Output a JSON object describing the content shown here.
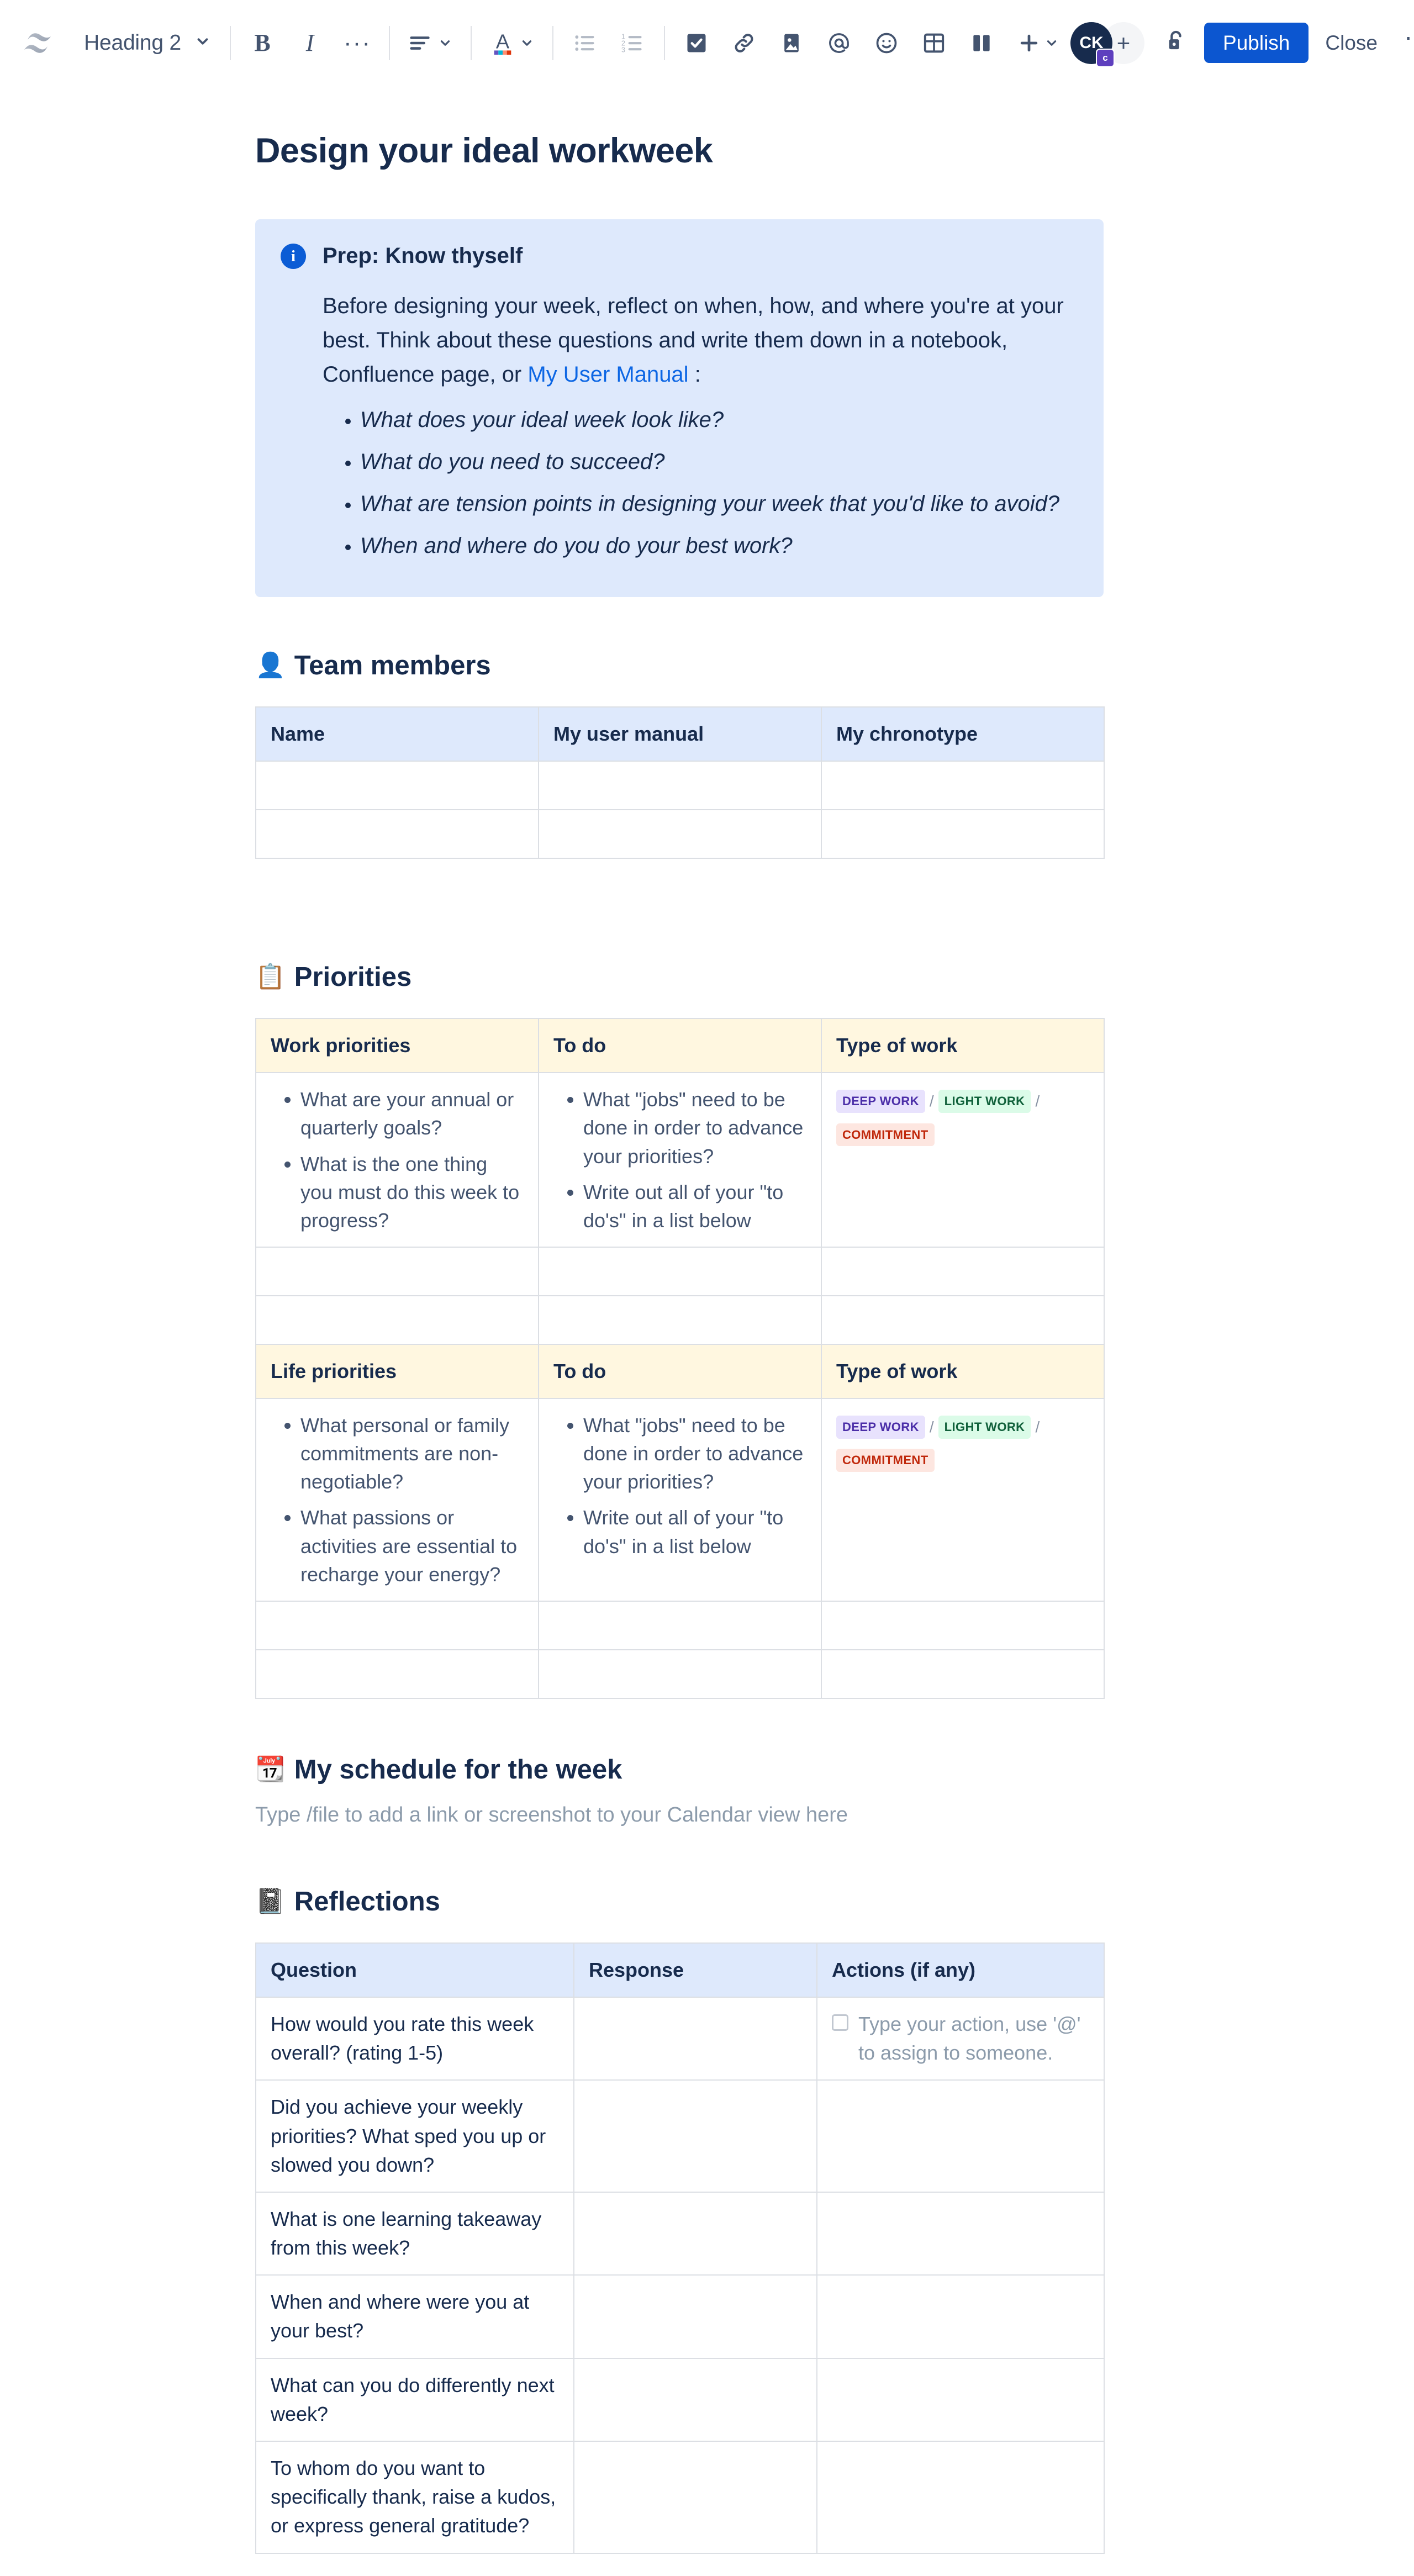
{
  "toolbar": {
    "logo_icon": "confluence-logo-icon",
    "block_type": "Heading 2",
    "bold_label": "B",
    "italic_label": "I",
    "more_formatting_label": "···",
    "icons": [
      "text-align-icon",
      "text-color-icon",
      "bullet-list-icon",
      "numbered-list-icon",
      "action-item-icon",
      "link-icon",
      "image-icon",
      "mention-icon",
      "emoji-icon",
      "table-icon",
      "layout-icon",
      "insert-more-icon"
    ],
    "avatar_initials": "CK",
    "avatar_badge": "c",
    "add_person_label": "+",
    "lock_icon": "unlocked-padlock-icon",
    "publish_label": "Publish",
    "close_label": "Close",
    "overflow_label": "···",
    "accent_color": "#0C56D0"
  },
  "document": {
    "title": "Design your ideal workweek"
  },
  "info_panel": {
    "icon": "info-icon",
    "title": "Prep: Know thyself",
    "body_before_link": "Before designing your week, reflect on when, how, and where you're at your best. Think about these questions and write them down in a notebook, Confluence page, or ",
    "link_text": "My User Manual",
    "body_after_link": " :",
    "questions": [
      "What does your ideal week look like?",
      "What do you need to succeed?",
      "What are tension points in designing your week that you'd like to avoid?",
      "When and where do you do your best work?"
    ],
    "background_color": "#DEE9FC"
  },
  "sections": {
    "team_members": {
      "emoji": "👤",
      "emoji_name": "bust-in-silhouette-emoji",
      "title": "Team members",
      "headers": [
        "Name",
        "My user manual",
        "My chronotype"
      ],
      "link_header_index": 2,
      "rows": [
        [
          "",
          "",
          ""
        ],
        [
          "",
          "",
          ""
        ]
      ]
    },
    "priorities": {
      "emoji": "📋",
      "emoji_name": "clipboard-emoji",
      "title": "Priorities",
      "work": {
        "headers": [
          "Work priorities",
          "To do",
          "Type of work"
        ],
        "col1_bullets": [
          "What are your annual or quarterly goals?",
          "What is the one thing you must do this week to progress?"
        ],
        "col2_bullets": [
          "What \"jobs\" need to be done in order to advance your priorities?",
          "Write out all of your \"to do's\" in a list below"
        ],
        "lozenges": [
          "DEEP WORK",
          "LIGHT WORK",
          "COMMITMENT"
        ],
        "empty_rows": 2
      },
      "life": {
        "headers": [
          "Life priorities",
          "To do",
          "Type of work"
        ],
        "col1_bullets": [
          "What personal or family commitments are non-negotiable?",
          "What passions or activities are essential to recharge your energy?"
        ],
        "col2_bullets": [
          "What \"jobs\" need to be done in order to advance your priorities?",
          "Write out all of your \"to do's\" in a list below"
        ],
        "lozenges": [
          "DEEP WORK",
          "LIGHT WORK",
          "COMMITMENT"
        ],
        "empty_rows": 2
      },
      "loz_separator": "/",
      "loz_colors": {
        "deep_work_bg": "#E8E2FD",
        "deep_work_fg": "#4B2EA8",
        "light_work_bg": "#DBFBE8",
        "light_work_fg": "#11613B",
        "commitment_bg": "#FDE6E0",
        "commitment_fg": "#C0280B"
      }
    },
    "schedule": {
      "emoji": "📆",
      "emoji_name": "calendar-emoji",
      "title": "My schedule for the week",
      "placeholder": "Type /file to add a link or screenshot to your Calendar view here"
    },
    "reflections": {
      "emoji": "📓",
      "emoji_name": "notebook-emoji",
      "title": "Reflections",
      "headers": [
        "Question",
        "Response",
        "Actions (if any)"
      ],
      "action_placeholder": "Type your action, use '@' to assign to someone.",
      "rows": [
        "How would you rate this week overall? (rating 1-5)",
        "Did you achieve your weekly priorities? What sped you up or slowed you down?",
        "What is one learning takeaway from this week?",
        "When and where were you at your best?",
        "What can you do differently next week?",
        "To whom do you want to specifically thank, raise a kudos, or express general gratitude?"
      ]
    }
  }
}
